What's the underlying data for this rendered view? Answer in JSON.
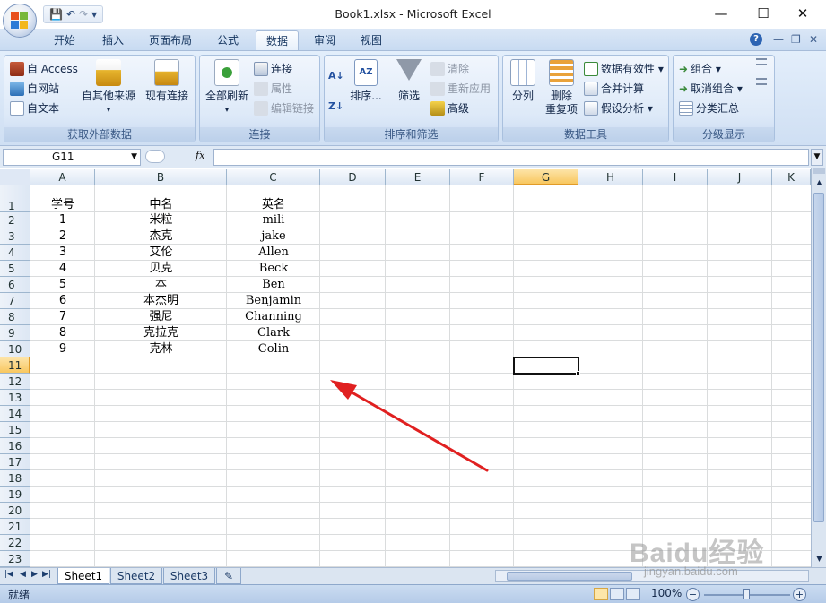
{
  "window": {
    "title": "Book1.xlsx - Microsoft Excel",
    "minimize": "—",
    "maximize": "☐",
    "close": "✕"
  },
  "qat": {
    "save": "💾",
    "undo": "↶",
    "redo": "↷",
    "more": "▾"
  },
  "tabs": [
    "开始",
    "插入",
    "页面布局",
    "公式",
    "数据",
    "审阅",
    "视图"
  ],
  "active_tab": "数据",
  "ribbon": {
    "external": {
      "label": "获取外部数据",
      "access": "自 Access",
      "web": "自网站",
      "text": "自文本",
      "other_line1": "自其他来源",
      "other_line2": "▾",
      "existing": "现有连接"
    },
    "connections": {
      "label": "连接",
      "refresh_line1": "全部刷新",
      "refresh_line2": "▾",
      "connections": "连接",
      "properties": "属性",
      "edit_links": "编辑链接"
    },
    "sort_filter": {
      "label": "排序和筛选",
      "sort": "排序...",
      "filter": "筛选",
      "clear": "清除",
      "reapply": "重新应用",
      "advanced": "高级"
    },
    "data_tools": {
      "label": "数据工具",
      "split": "分列",
      "remove_line1": "删除",
      "remove_line2": "重复项",
      "validation": "数据有效性 ▾",
      "consolidate": "合并计算",
      "whatif": "假设分析 ▾"
    },
    "outline": {
      "label": "分级显示",
      "group": "组合 ▾",
      "ungroup": "取消组合 ▾",
      "subtotal": "分类汇总"
    }
  },
  "formula_bar": {
    "name_box": "G11",
    "fx": "fx",
    "formula": ""
  },
  "columns": [
    "A",
    "B",
    "C",
    "D",
    "E",
    "F",
    "G",
    "H",
    "I",
    "J",
    "K"
  ],
  "rows": [
    "1",
    "2",
    "3",
    "4",
    "5",
    "6",
    "7",
    "8",
    "9",
    "10",
    "11",
    "12",
    "13",
    "14",
    "15",
    "16",
    "17",
    "18",
    "19",
    "20",
    "21",
    "22",
    "23"
  ],
  "selected_cell": "G11",
  "cells": {
    "header": [
      "学号",
      "中名",
      "英名"
    ],
    "data": [
      [
        "1",
        "米粒",
        "mili"
      ],
      [
        "2",
        "杰克",
        "jake"
      ],
      [
        "3",
        "艾伦",
        "Allen"
      ],
      [
        "4",
        "贝克",
        "Beck"
      ],
      [
        "5",
        "本",
        "Ben"
      ],
      [
        "6",
        "本杰明",
        "Benjamin"
      ],
      [
        "7",
        "强尼",
        "Channing"
      ],
      [
        "8",
        "克拉克",
        "Clark"
      ],
      [
        "9",
        "克林",
        "Colin"
      ]
    ]
  },
  "sheets": [
    "Sheet1",
    "Sheet2",
    "Sheet3"
  ],
  "active_sheet": "Sheet1",
  "status": {
    "text": "就绪",
    "zoom": "100%"
  },
  "watermark": {
    "brand": "Baidu经验",
    "url": "jingyan.baidu.com"
  },
  "colors": {
    "selection": "#f8c760",
    "ribbon": "#dde9f8",
    "arrow": "#e02020"
  }
}
